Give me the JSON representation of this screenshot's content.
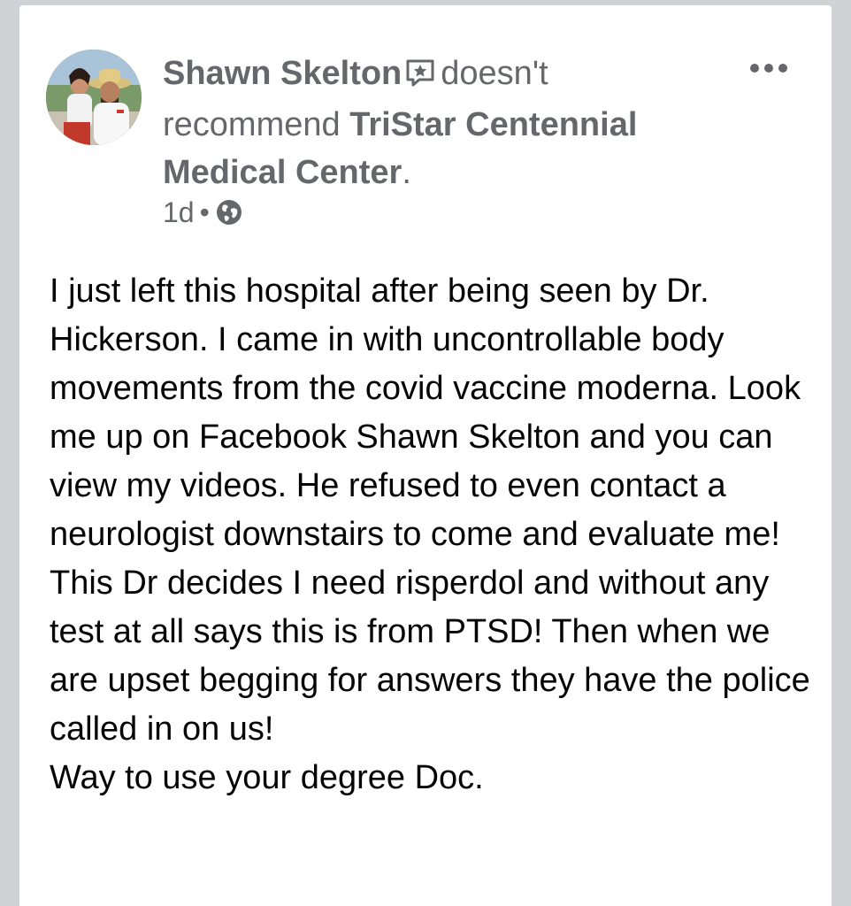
{
  "post": {
    "author_name": "Shawn Skelton",
    "action_text": "doesn't recommend",
    "page_name": "TriStar Centennial Medical Center",
    "trailing_period": ".",
    "timestamp": "1d",
    "separator": "•",
    "audience_icon": "globe-icon",
    "author_badge_icon": "review-badge-icon",
    "more_icon": "more-options-icon",
    "body": "I just left this hospital after being seen by Dr. Hickerson. I came in with uncontrollable body movements from the covid vaccine moderna. Look me up on Facebook Shawn Skelton and you can view my videos. He refused to even contact a neurologist downstairs to come and evaluate me! This Dr decides I need risperdol and without any test at all says this is from PTSD! Then when we are upset begging for answers they have the police called in on us!\nWay to use your degree Doc."
  },
  "colors": {
    "background": "#d0d2d5",
    "card": "#ffffff",
    "primary_text": "#050505",
    "secondary_text": "#65676b"
  }
}
